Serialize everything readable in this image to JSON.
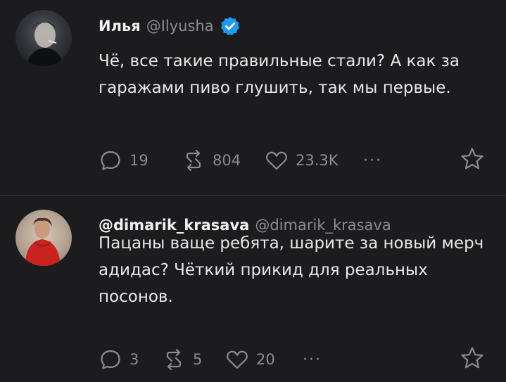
{
  "posts": [
    {
      "author_name": "Илья",
      "handle": "@Ilyusha",
      "verified": true,
      "text": "Чё, все такие правильные стали? А как за гаражами пиво глушить, так мы первые.",
      "replies": "19",
      "reposts": "804",
      "likes": "23.3K",
      "more": "···"
    },
    {
      "author_name": "@dimarik_krasava",
      "handle": "@dimarik_krasava",
      "verified": false,
      "text": "Пацаны ваще ребята, шарите за новый мерч адидас? Чёткий прикид для реальных посонов.",
      "replies": "3",
      "reposts": "5",
      "likes": "20",
      "more": "···"
    }
  ],
  "icons": {
    "reply": "reply-icon",
    "repost": "repost-icon",
    "like": "heart-icon",
    "more": "more-icon",
    "star": "star-icon",
    "verified": "verified-badge-icon"
  },
  "colors": {
    "background": "#1c1c1e",
    "text": "#e8e8e8",
    "muted": "#8a8d91",
    "verified": "#1d9bf0"
  }
}
